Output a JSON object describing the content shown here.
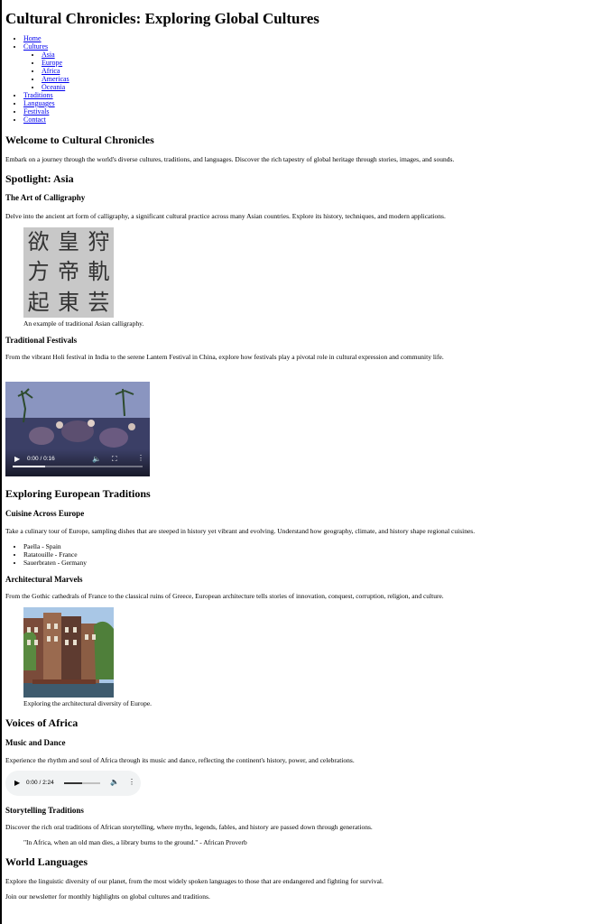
{
  "page": {
    "title": "Cultural Chronicles: Exploring Global Cultures"
  },
  "nav": {
    "items": [
      {
        "label": "Home"
      },
      {
        "label": "Cultures",
        "children": [
          {
            "label": "Asia"
          },
          {
            "label": "Europe"
          },
          {
            "label": "Africa"
          },
          {
            "label": "Americas"
          },
          {
            "label": "Oceania"
          }
        ]
      },
      {
        "label": "Traditions"
      },
      {
        "label": "Languages"
      },
      {
        "label": "Festivals"
      },
      {
        "label": "Contact"
      }
    ]
  },
  "welcome": {
    "heading": "Welcome to Cultural Chronicles",
    "text": "Embark on a journey through the world's diverse cultures, traditions, and languages. Discover the rich tapestry of global heritage through stories, images, and sounds."
  },
  "asia": {
    "heading": "Spotlight: Asia",
    "calligraphy": {
      "heading": "The Art of Calligraphy",
      "text": "Delve into the ancient art form of calligraphy, a significant cultural practice across many Asian countries. Explore its history, techniques, and modern applications.",
      "caption": "An example of traditional Asian calligraphy.",
      "glyphs": [
        "欲",
        "皇",
        "狩",
        "方",
        "帝",
        "軌",
        "起",
        "東",
        "芸"
      ]
    },
    "festivals": {
      "heading": "Traditional Festivals",
      "text": "From the vibrant Holi festival in India to the serene Lantern Festival in China, explore how festivals play a pivotal role in cultural expression and community life.",
      "video_time": "0:00 / 0:16"
    }
  },
  "europe": {
    "heading": "Exploring European Traditions",
    "cuisine": {
      "heading": "Cuisine Across Europe",
      "text": "Take a culinary tour of Europe, sampling dishes that are steeped in history yet vibrant and evolving. Understand how geography, climate, and history shape regional cuisines.",
      "dishes": [
        "Paella - Spain",
        "Ratatouille - France",
        "Sauerbraten - Germany"
      ]
    },
    "architecture": {
      "heading": "Architectural Marvels",
      "text": "From the Gothic cathedrals of France to the classical ruins of Greece, European architecture tells stories of innovation, conquest, corruption, religion, and culture.",
      "caption": "Exploring the architectural diversity of Europe."
    }
  },
  "africa": {
    "heading": "Voices of Africa",
    "music": {
      "heading": "Music and Dance",
      "text": "Experience the rhythm and soul of Africa through its music and dance, reflecting the continent's history, power, and celebrations.",
      "audio_time": "0:00 / 2:24"
    },
    "story": {
      "heading": "Storytelling Traditions",
      "text": "Discover the rich oral traditions of African storytelling, where myths, legends, fables, and history are passed down through generations.",
      "quote": "\"In Africa, when an old man dies, a library burns to the ground.\" - African Proverb"
    }
  },
  "languages": {
    "heading": "World Languages",
    "text": "Explore the linguistic diversity of our planet, from the most widely spoken languages to those that are endangered and fighting for survival.",
    "newsletter": "Join our newsletter for monthly highlights on global cultures and traditions."
  }
}
